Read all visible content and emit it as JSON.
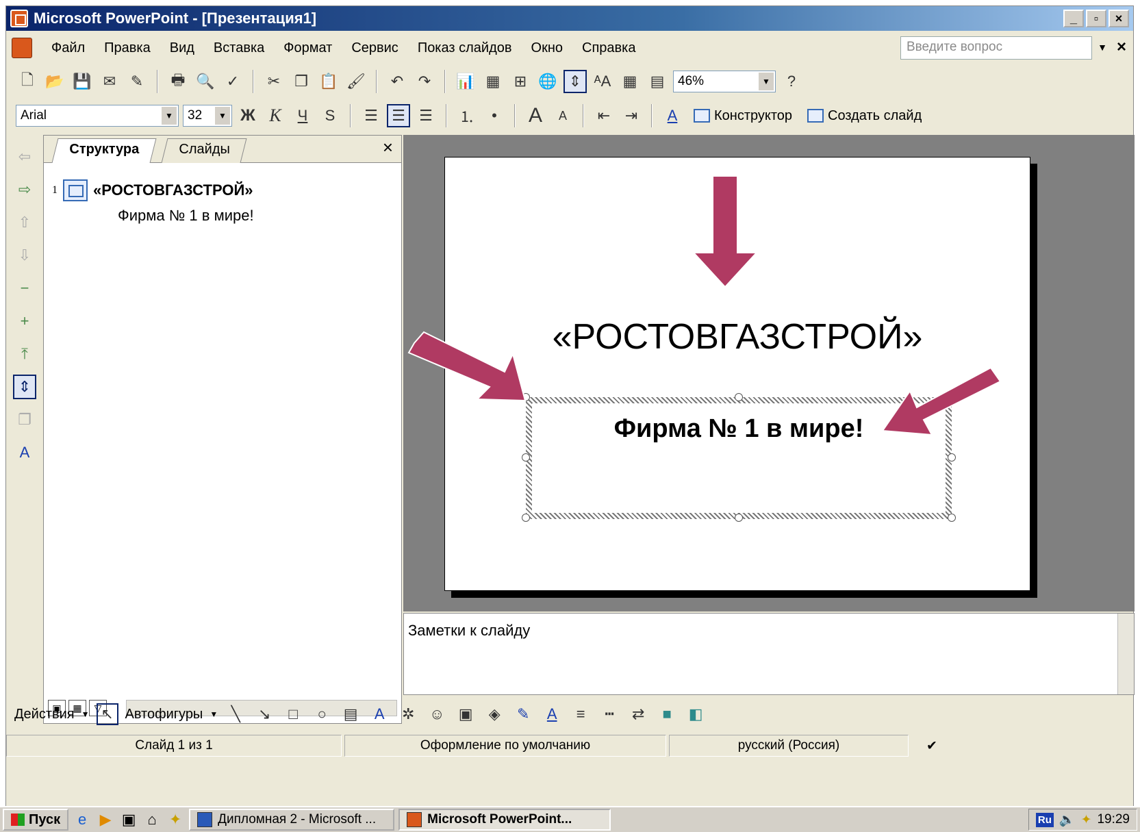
{
  "window": {
    "title": "Microsoft PowerPoint - [Презентация1]"
  },
  "menu": {
    "items": [
      "Файл",
      "Правка",
      "Вид",
      "Вставка",
      "Формат",
      "Сервис",
      "Показ слайдов",
      "Окно",
      "Справка"
    ],
    "help_placeholder": "Введите вопрос"
  },
  "toolbar": {
    "zoom": "46%"
  },
  "format_toolbar": {
    "font": "Arial",
    "size": "32",
    "bold": "Ж",
    "italic": "К",
    "underline": "Ч",
    "shadow": "S",
    "designer": "Конструктор",
    "new_slide": "Создать слайд"
  },
  "outline_pane": {
    "tab_structure": "Структура",
    "tab_slides": "Слайды",
    "close": "×",
    "slide_number": "1",
    "title": "«РОСТОВГАЗСТРОЙ»",
    "subtitle": "Фирма № 1 в мире!"
  },
  "slide": {
    "title": "«РОСТОВГАЗСТРОЙ»",
    "subtitle": "Фирма № 1 в мире!",
    "arrow_color": "#b03a62"
  },
  "notes": {
    "text": "Заметки к слайду"
  },
  "drawing_toolbar": {
    "actions": "Действия",
    "autoshapes": "Автофигуры"
  },
  "status": {
    "slide": "Слайд 1 из 1",
    "design": "Оформление по умолчанию",
    "language": "русский (Россия)"
  },
  "taskbar": {
    "start": "Пуск",
    "task1": "Дипломная 2 - Microsoft ...",
    "task2": "Microsoft PowerPoint...",
    "lang": "Ru",
    "time": "19:29"
  }
}
